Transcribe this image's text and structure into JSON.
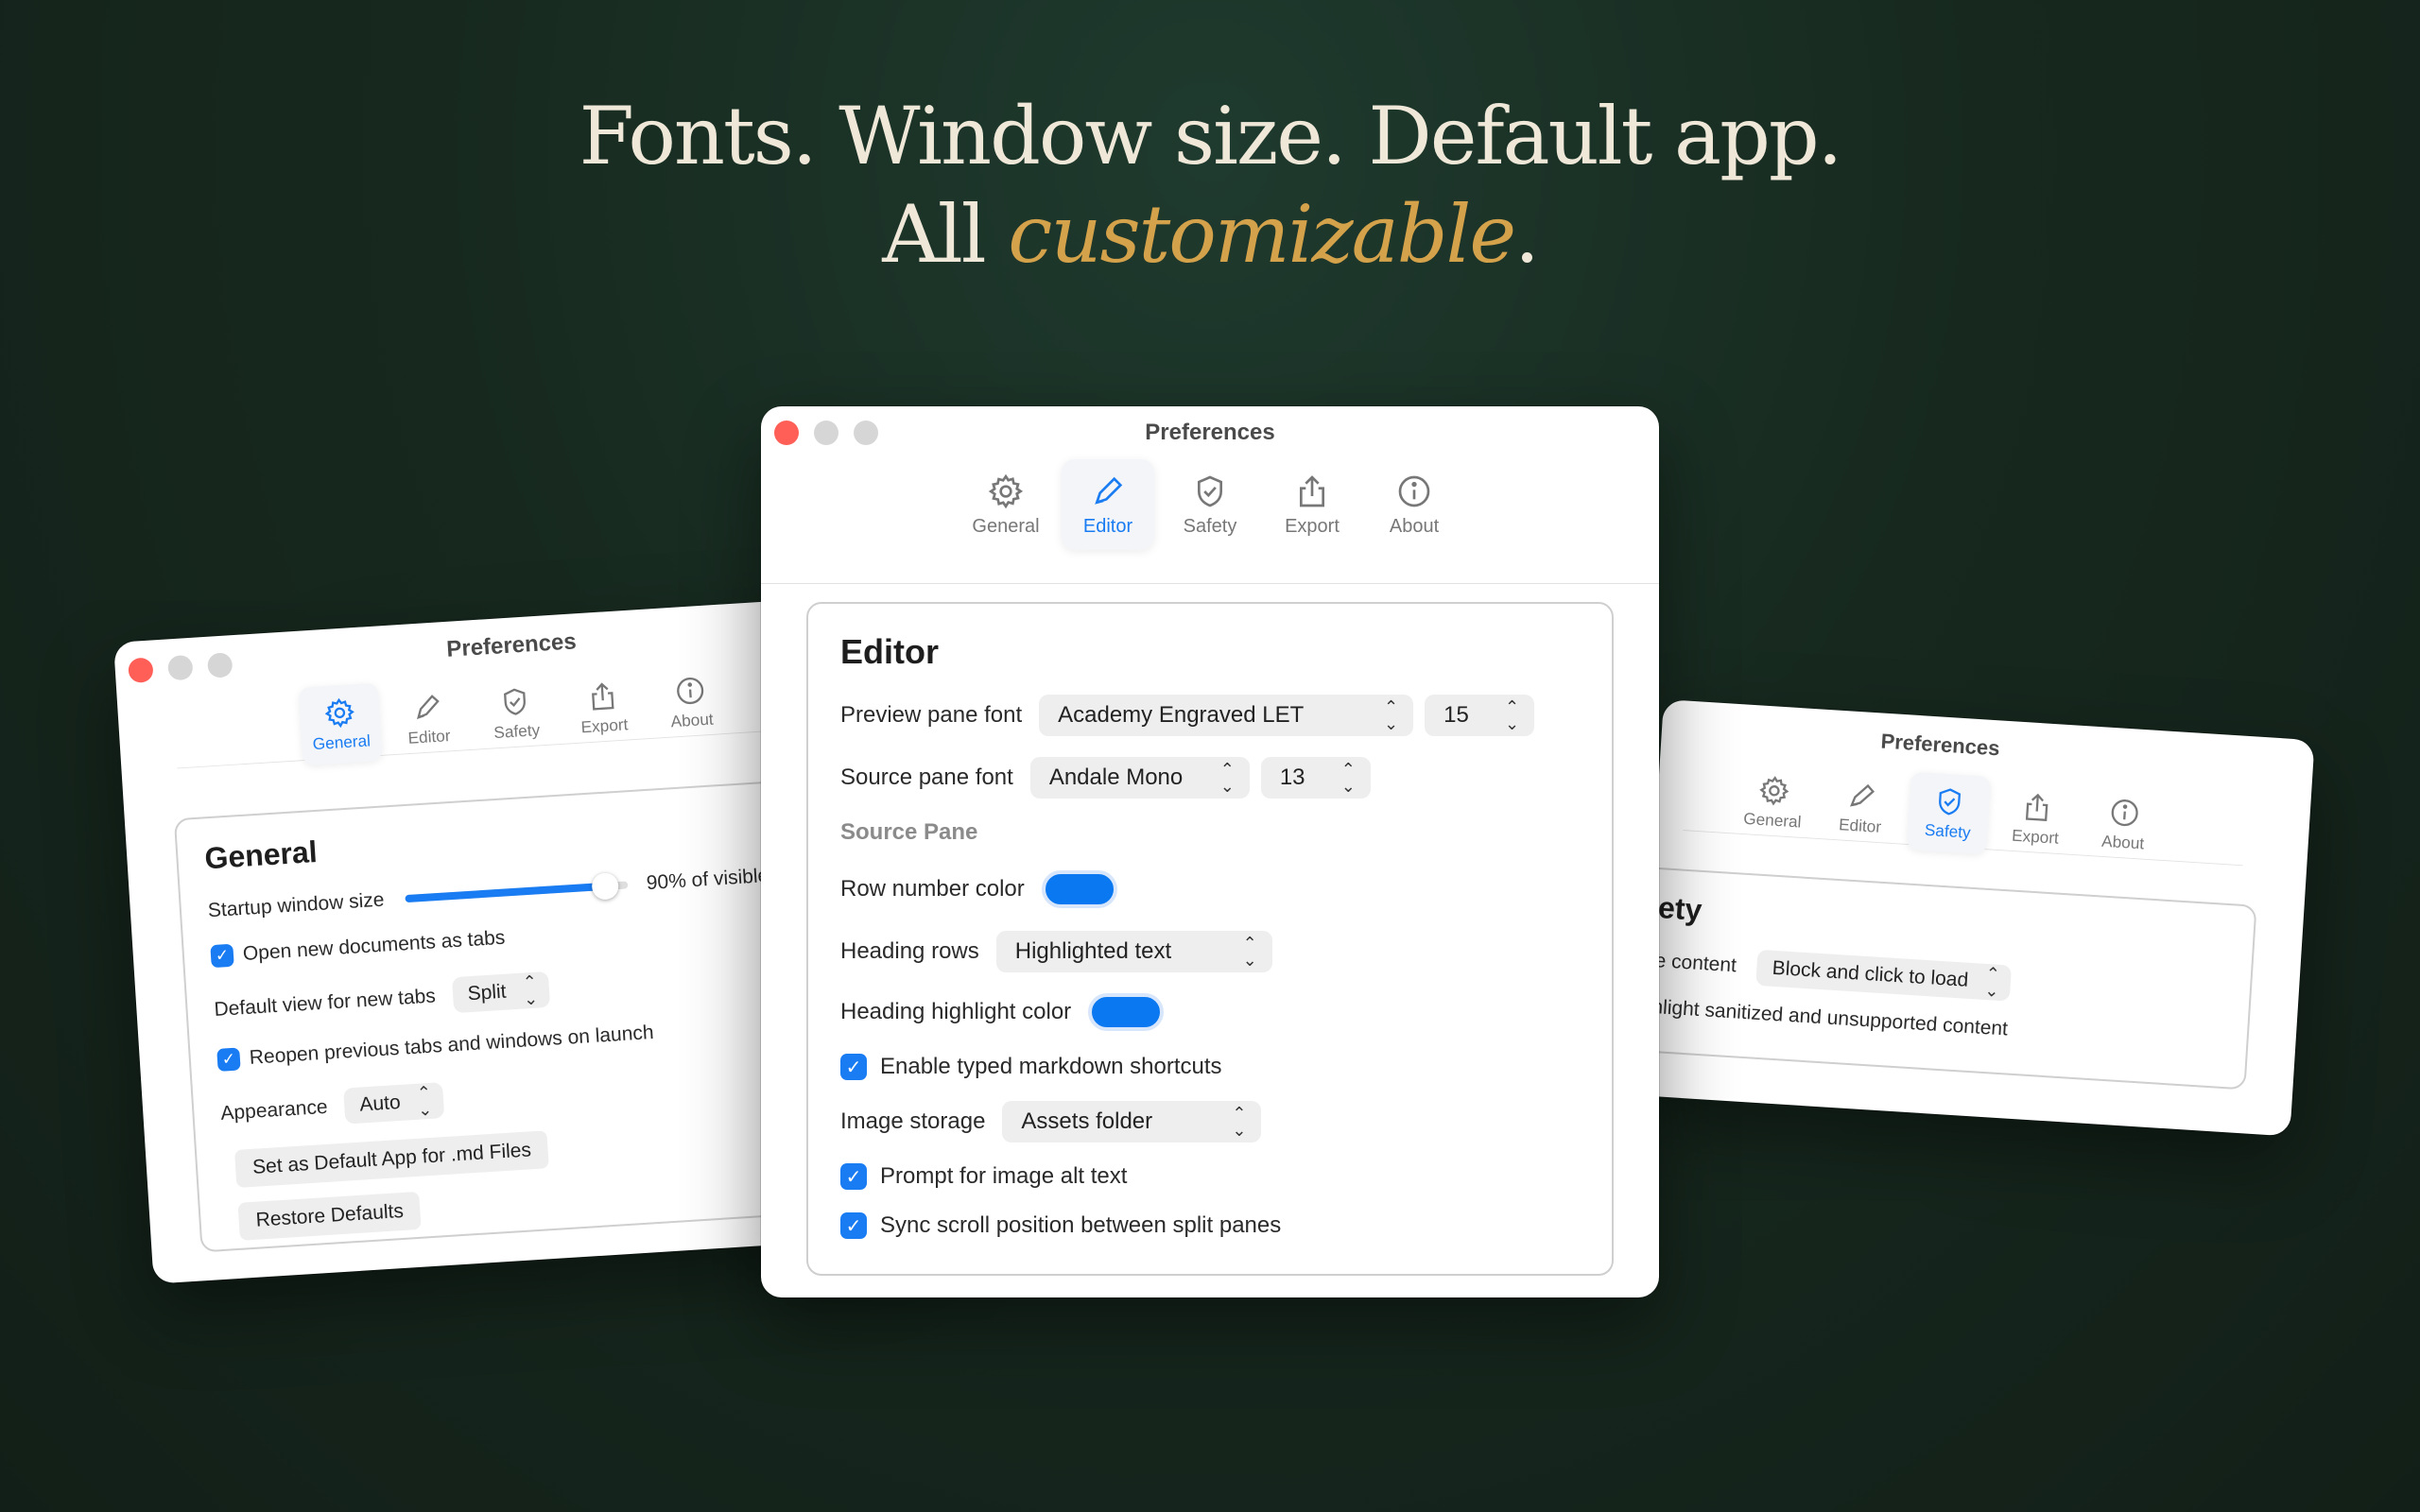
{
  "headline": {
    "line1": "Fonts. Window size. Default app.",
    "line2_prefix": "All ",
    "line2_accent": "customizable",
    "line2_suffix": "."
  },
  "colors": {
    "accent_gold": "#d4a24a",
    "blue": "#1a7cf2",
    "bg": "#17291f"
  },
  "tabs": [
    {
      "label": "General",
      "icon": "gear-icon"
    },
    {
      "label": "Editor",
      "icon": "pencil-icon"
    },
    {
      "label": "Safety",
      "icon": "shield-icon"
    },
    {
      "label": "Export",
      "icon": "share-icon"
    },
    {
      "label": "About",
      "icon": "info-icon"
    }
  ],
  "window_title": "Preferences",
  "general": {
    "title": "General",
    "startup_label": "Startup window size",
    "startup_value_text": "90% of visible s",
    "startup_fraction": 0.9,
    "open_tabs_label": "Open new documents as tabs",
    "default_view_label": "Default view for new tabs",
    "default_view_value": "Split",
    "reopen_label": "Reopen previous tabs and windows on launch",
    "appearance_label": "Appearance",
    "appearance_value": "Auto",
    "set_default_button": "Set as Default App for .md Files",
    "restore_button": "Restore Defaults"
  },
  "editor": {
    "title": "Editor",
    "preview_font_label": "Preview pane font",
    "preview_font_value": "Academy Engraved LET",
    "preview_font_size": "15",
    "source_font_label": "Source pane font",
    "source_font_value": "Andale Mono",
    "source_font_size": "13",
    "source_pane_section": "Source Pane",
    "row_number_color_label": "Row number color",
    "heading_rows_label": "Heading rows",
    "heading_rows_value": "Highlighted text",
    "heading_highlight_label": "Heading highlight color",
    "typed_shortcuts_label": "Enable typed markdown shortcuts",
    "image_storage_label": "Image storage",
    "image_storage_value": "Assets folder",
    "alt_text_label": "Prompt for image alt text",
    "sync_scroll_label": "Sync scroll position between split panes"
  },
  "safety": {
    "title": "ety",
    "content_label": "e content",
    "content_value": "Block and click to load",
    "highlight_label": "hlight sanitized and unsupported content"
  }
}
